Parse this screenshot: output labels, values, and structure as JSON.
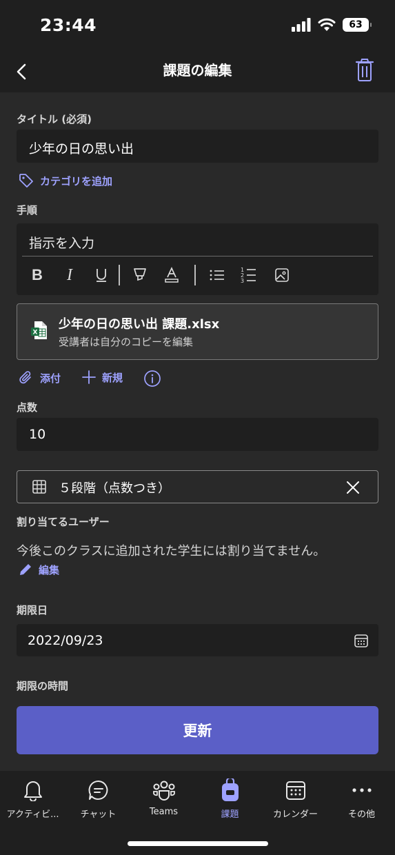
{
  "status": {
    "time": "23:44",
    "battery": "63"
  },
  "nav": {
    "title": "課題の編集"
  },
  "form": {
    "title_label": "タイトル (必須)",
    "title_value": "少年の日の思い出",
    "add_category": "カテゴリを追加",
    "instructions_label": "手順",
    "instructions_placeholder": "指示を入力",
    "attachment": {
      "name": "少年の日の思い出 課題.xlsx",
      "subtitle": "受講者は自分のコピーを編集"
    },
    "attach_label": "添付",
    "new_label": "新規",
    "points_label": "点数",
    "points_value": "10",
    "rubric_label": "５段階（点数つき）",
    "assign_label": "割り当てるユーザー",
    "assign_text": "今後このクラスに追加された学生には割り当てません。",
    "edit_label": "編集",
    "due_date_label": "期限日",
    "due_date_value": "2022/09/23",
    "due_time_label": "期限の時間",
    "update_button": "更新"
  },
  "tabs": [
    {
      "label": "アクティビ...",
      "icon": "bell-icon",
      "active": false
    },
    {
      "label": "チャット",
      "icon": "chat-icon",
      "active": false
    },
    {
      "label": "Teams",
      "icon": "teams-icon",
      "active": false
    },
    {
      "label": "課題",
      "icon": "backpack-icon",
      "active": true
    },
    {
      "label": "カレンダー",
      "icon": "calendar-icon",
      "active": false
    },
    {
      "label": "その他",
      "icon": "more-icon",
      "active": false
    }
  ],
  "colors": {
    "accent": "#9ea2ff",
    "button": "#5b5fc7",
    "background": "#292929",
    "field": "#1f1f1f",
    "excel": "#1d6f42"
  }
}
